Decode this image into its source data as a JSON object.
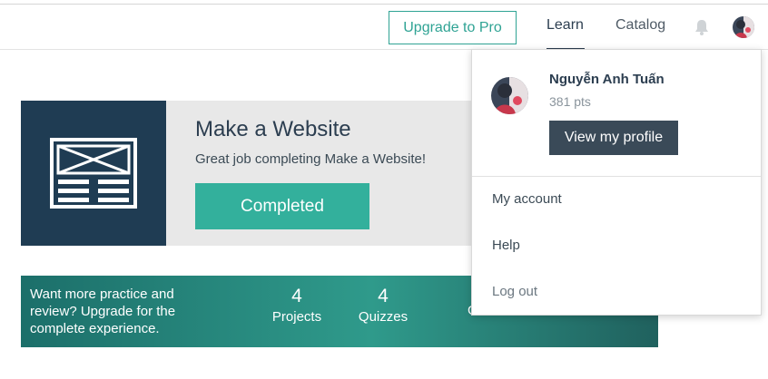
{
  "nav": {
    "upgrade_label": "Upgrade to Pro",
    "learn_label": "Learn",
    "catalog_label": "Catalog",
    "bell_icon": "bell-icon",
    "avatar_icon": "user-avatar"
  },
  "course": {
    "title": "Make a Website",
    "subtitle": "Great job completing Make a Website!",
    "button_label": "Completed",
    "thumbnail_icon": "website-layout-icon"
  },
  "banner": {
    "text": "Want more practice and review? Upgrade for the complete experience.",
    "projects_count": "4",
    "projects_label": "Projects",
    "quizzes_count": "4",
    "quizzes_label": "Quizzes",
    "cta_label": "Get Instant Access »"
  },
  "dropdown": {
    "user_name": "Nguyễn Anh Tuấn",
    "points": "381 pts",
    "view_profile_label": "View my profile",
    "menu": {
      "account": "My account",
      "help": "Help",
      "logout": "Log out"
    }
  },
  "colors": {
    "accent_teal": "#33b09c",
    "dark_navy": "#1f3c53",
    "profile_button": "#3a4a58"
  }
}
